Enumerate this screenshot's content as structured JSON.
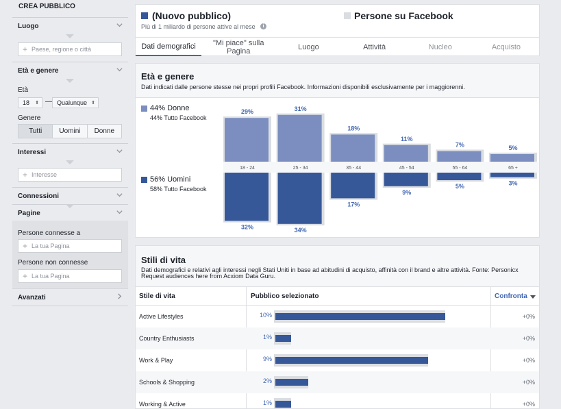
{
  "sidebar": {
    "title": "CREA PUBBLICO",
    "luogo": {
      "label": "Luogo",
      "placeholder": "Paese, regione o città"
    },
    "eta_genere": {
      "label": "Età e genere",
      "eta_label": "Età",
      "age_from": "18",
      "dash": "—",
      "age_to": "Qualunque",
      "genere_label": "Genere",
      "genders": [
        "Tutti",
        "Uomini",
        "Donne"
      ],
      "selected_gender": "Tutti"
    },
    "interessi": {
      "label": "Interessi",
      "placeholder": "Interesse"
    },
    "connessioni": {
      "label": "Connessioni"
    },
    "pagine": {
      "label": "Pagine",
      "connected_label": "Persone connesse a",
      "connected_placeholder": "La tua Pagina",
      "not_connected_label": "Persone non connesse",
      "not_connected_placeholder": "La tua Pagina"
    },
    "avanzati": {
      "label": "Avanzati"
    }
  },
  "header": {
    "audience_title": "(Nuovo pubblico)",
    "audience_sub": "Più di 1 miliardo di persone attive al mese",
    "compare_title": "Persone su Facebook",
    "audience_color": "#365899",
    "compare_color": "#dadde1",
    "tabs": [
      {
        "label": "Dati demografici",
        "state": "active"
      },
      {
        "label": "\"Mi piace\" sulla Pagina",
        "state": "normal"
      },
      {
        "label": "Luogo",
        "state": "normal"
      },
      {
        "label": "Attività",
        "state": "normal"
      },
      {
        "label": "Nucleo",
        "state": "dim"
      },
      {
        "label": "Acquisto",
        "state": "dim"
      }
    ]
  },
  "age_gender": {
    "title": "Età e genere",
    "description": "Dati indicati dalle persone stesse nei propri profili Facebook. Informazioni disponibili esclusivamente per i maggiorenni.",
    "women": {
      "label": "44% Donne",
      "sub": "44% Tutto Facebook",
      "color": "#7b8ebf"
    },
    "men": {
      "label": "56% Uomini",
      "sub": "58% Tutto Facebook",
      "color": "#365899"
    },
    "compare_color": "#dadde1"
  },
  "chart_data": {
    "type": "bar",
    "categories": [
      "18 - 24",
      "25 - 34",
      "35 - 44",
      "45 - 54",
      "55 - 64",
      "65 +"
    ],
    "series": [
      {
        "name": "Donne",
        "values": [
          29,
          31,
          18,
          11,
          7,
          5
        ],
        "labels": [
          "29%",
          "31%",
          "18%",
          "11%",
          "7%",
          "5%"
        ]
      },
      {
        "name": "Uomini",
        "values": [
          32,
          34,
          17,
          9,
          5,
          3
        ],
        "labels": [
          "32%",
          "34%",
          "17%",
          "9%",
          "5%",
          "3%"
        ]
      }
    ],
    "compare_women": [
      30,
      32,
      19,
      12,
      8,
      6
    ],
    "compare_men": [
      33,
      35,
      18,
      10,
      6,
      4
    ]
  },
  "lifestyle": {
    "title": "Stili di vita",
    "description_line1": "Dati demografici e relativi agli interessi negli Stati Uniti in base ad abitudini di acquisto, affinità con il brand e altre attività. Fonte: Personicx",
    "description_line2": "Request audiences here from Acxiom Data Guru.",
    "col_style": "Stile di vita",
    "col_selected": "Pubblico selezionato",
    "col_compare": "Confronta",
    "rows": [
      {
        "name": "Active Lifestyles",
        "pct": "10%",
        "value": 10,
        "compare": 10,
        "diff": "+0%"
      },
      {
        "name": "Country Enthusiasts",
        "pct": "1%",
        "value": 1,
        "compare": 1,
        "diff": "+0%"
      },
      {
        "name": "Work & Play",
        "pct": "9%",
        "value": 9,
        "compare": 9,
        "diff": "+0%"
      },
      {
        "name": "Schools & Shopping",
        "pct": "2%",
        "value": 2,
        "compare": 2,
        "diff": "+0%"
      },
      {
        "name": "Working & Active",
        "pct": "1%",
        "value": 1,
        "compare": 1,
        "diff": "+0%"
      }
    ]
  }
}
